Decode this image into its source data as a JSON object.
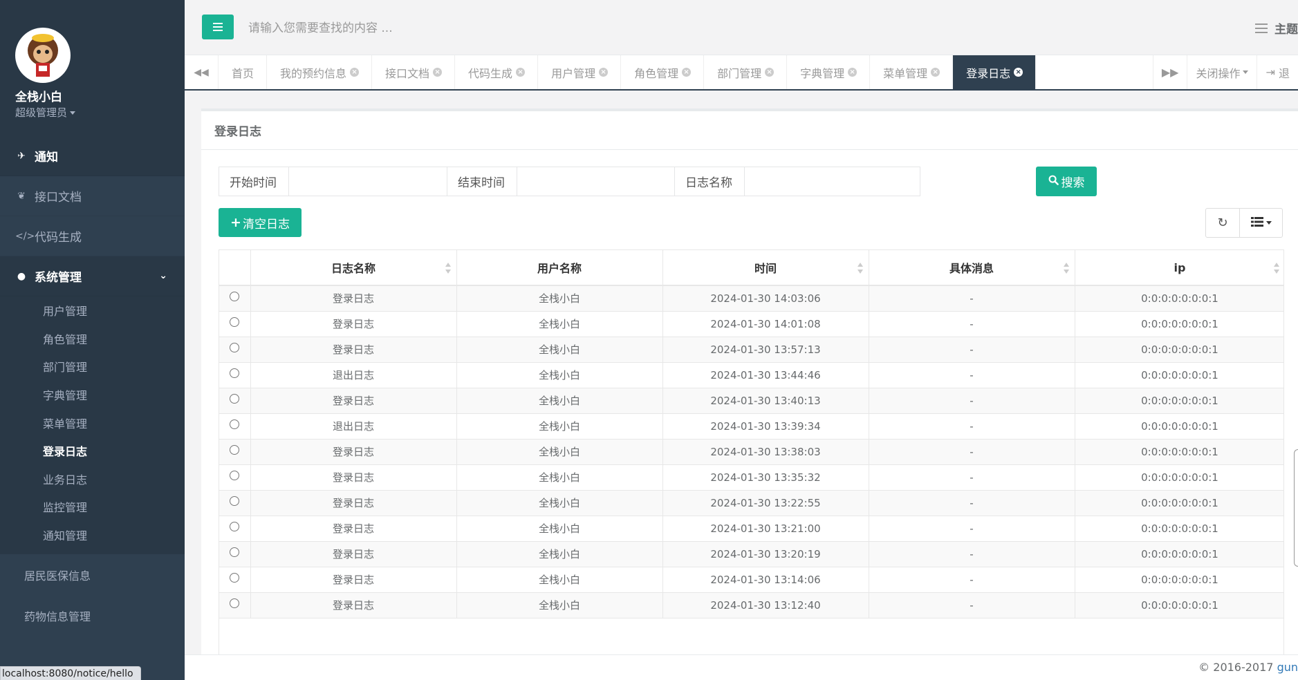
{
  "sidebar": {
    "user_name": "全栈小白",
    "user_role": "超级管理员",
    "menu": [
      {
        "label": "通知",
        "icon": "rocket-icon"
      },
      {
        "label": "接口文档",
        "icon": "leaf-icon"
      },
      {
        "label": "代码生成",
        "icon": "code-icon"
      }
    ],
    "system_label": "系统管理",
    "system_items": [
      "用户管理",
      "角色管理",
      "部门管理",
      "字典管理",
      "菜单管理",
      "登录日志",
      "业务日志",
      "监控管理",
      "通知管理"
    ],
    "extra_items": [
      "居民医保信息",
      "药物信息管理"
    ]
  },
  "statusbar": "localhost:8080/notice/hello",
  "header": {
    "search_placeholder": "请输入您需要查找的内容 ...",
    "theme_label": "主题"
  },
  "tabs": [
    "首页",
    "我的预约信息",
    "接口文档",
    "代码生成",
    "用户管理",
    "角色管理",
    "部门管理",
    "字典管理",
    "菜单管理",
    "登录日志"
  ],
  "tab_actions": {
    "close_ops": "关闭操作",
    "exit": "退"
  },
  "panel": {
    "title": "登录日志",
    "filters": {
      "start_time": "开始时间",
      "end_time": "结束时间",
      "log_name": "日志名称"
    },
    "search_button": "搜索",
    "clear_button": "清空日志"
  },
  "table": {
    "headers": [
      "日志名称",
      "用户名称",
      "时间",
      "具体消息",
      "ip"
    ],
    "rows": [
      [
        "登录日志",
        "全栈小白",
        "2024-01-30 14:03:06",
        "-",
        "0:0:0:0:0:0:0:1"
      ],
      [
        "登录日志",
        "全栈小白",
        "2024-01-30 14:01:08",
        "-",
        "0:0:0:0:0:0:0:1"
      ],
      [
        "登录日志",
        "全栈小白",
        "2024-01-30 13:57:13",
        "-",
        "0:0:0:0:0:0:0:1"
      ],
      [
        "退出日志",
        "全栈小白",
        "2024-01-30 13:44:46",
        "-",
        "0:0:0:0:0:0:0:1"
      ],
      [
        "登录日志",
        "全栈小白",
        "2024-01-30 13:40:13",
        "-",
        "0:0:0:0:0:0:0:1"
      ],
      [
        "退出日志",
        "全栈小白",
        "2024-01-30 13:39:34",
        "-",
        "0:0:0:0:0:0:0:1"
      ],
      [
        "登录日志",
        "全栈小白",
        "2024-01-30 13:38:03",
        "-",
        "0:0:0:0:0:0:0:1"
      ],
      [
        "登录日志",
        "全栈小白",
        "2024-01-30 13:35:32",
        "-",
        "0:0:0:0:0:0:0:1"
      ],
      [
        "登录日志",
        "全栈小白",
        "2024-01-30 13:22:55",
        "-",
        "0:0:0:0:0:0:0:1"
      ],
      [
        "登录日志",
        "全栈小白",
        "2024-01-30 13:21:00",
        "-",
        "0:0:0:0:0:0:0:1"
      ],
      [
        "登录日志",
        "全栈小白",
        "2024-01-30 13:20:19",
        "-",
        "0:0:0:0:0:0:0:1"
      ],
      [
        "登录日志",
        "全栈小白",
        "2024-01-30 13:14:06",
        "-",
        "0:0:0:0:0:0:0:1"
      ],
      [
        "登录日志",
        "全栈小白",
        "2024-01-30 13:12:40",
        "-",
        "0:0:0:0:0:0:0:1"
      ]
    ]
  },
  "footer": {
    "copyright": "© 2016-2017 ",
    "brand": "gun"
  },
  "colors": {
    "accent": "#1ab394",
    "sidebar": "#2f4050",
    "sidebar_dark": "#293846"
  }
}
